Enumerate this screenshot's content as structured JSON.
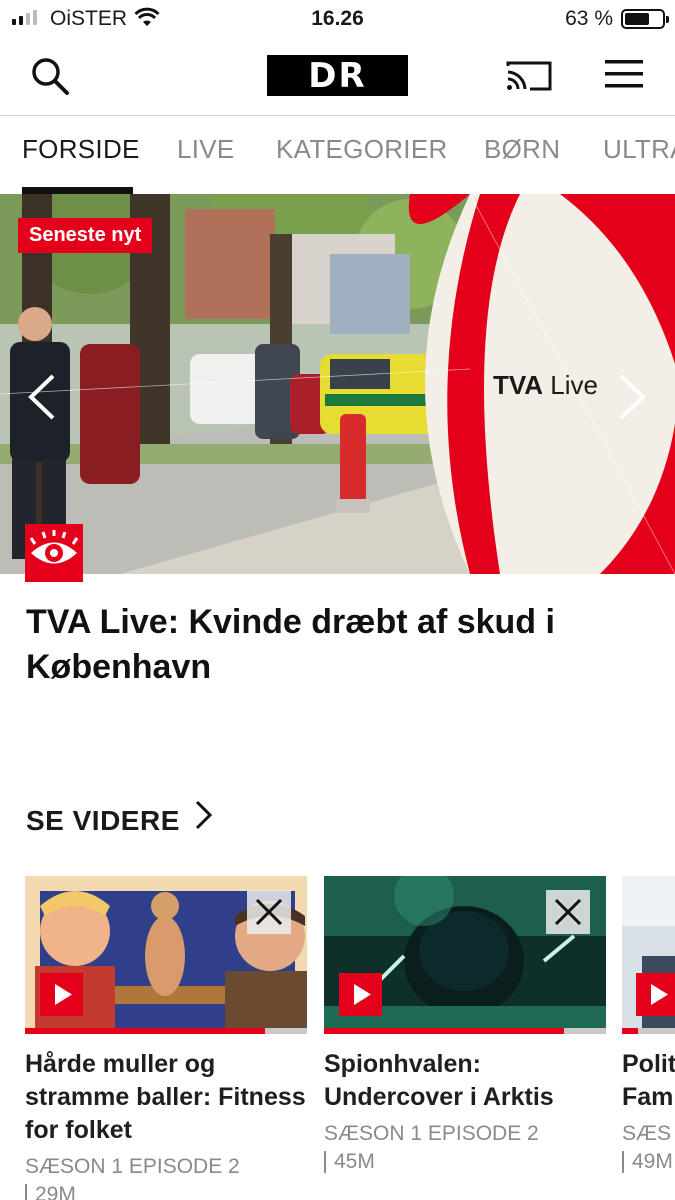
{
  "status_bar": {
    "carrier": "OiSTER",
    "time": "16.26",
    "battery": "63 %"
  },
  "header": {
    "logo": "DR",
    "icons": [
      "search-icon",
      "cast-icon",
      "menu-icon"
    ]
  },
  "tabs": [
    {
      "label": "FORSIDE",
      "active": true
    },
    {
      "label": "LIVE",
      "active": false
    },
    {
      "label": "KATEGORIER",
      "active": false
    },
    {
      "label": "BØRN",
      "active": false
    },
    {
      "label": "ULTRA",
      "active": false
    }
  ],
  "hero": {
    "badge": "Seneste nyt",
    "overlay_text_bold": "TVA",
    "overlay_text": " Live",
    "headline": "TVA Live: Kvinde dræbt af skud i København"
  },
  "section": {
    "title": "SE VIDERE"
  },
  "cards": [
    {
      "title": "Hårde muller og stramme baller: Fitness for folket",
      "season_episode": "SÆSON 1 EPISODE 2",
      "duration": "29M",
      "progress": 0.85
    },
    {
      "title": "Spionhvalen: Undercover i Arktis",
      "season_episode": "SÆSON 1 EPISODE 2",
      "duration": "45M",
      "progress": 0.85
    },
    {
      "title": "Polit Fam",
      "season_episode": "SÆS",
      "duration": "49M",
      "progress": 0.3
    }
  ],
  "colors": {
    "accent": "#e4001b",
    "text": "#1a1a1a",
    "muted": "#8a8a8a"
  }
}
